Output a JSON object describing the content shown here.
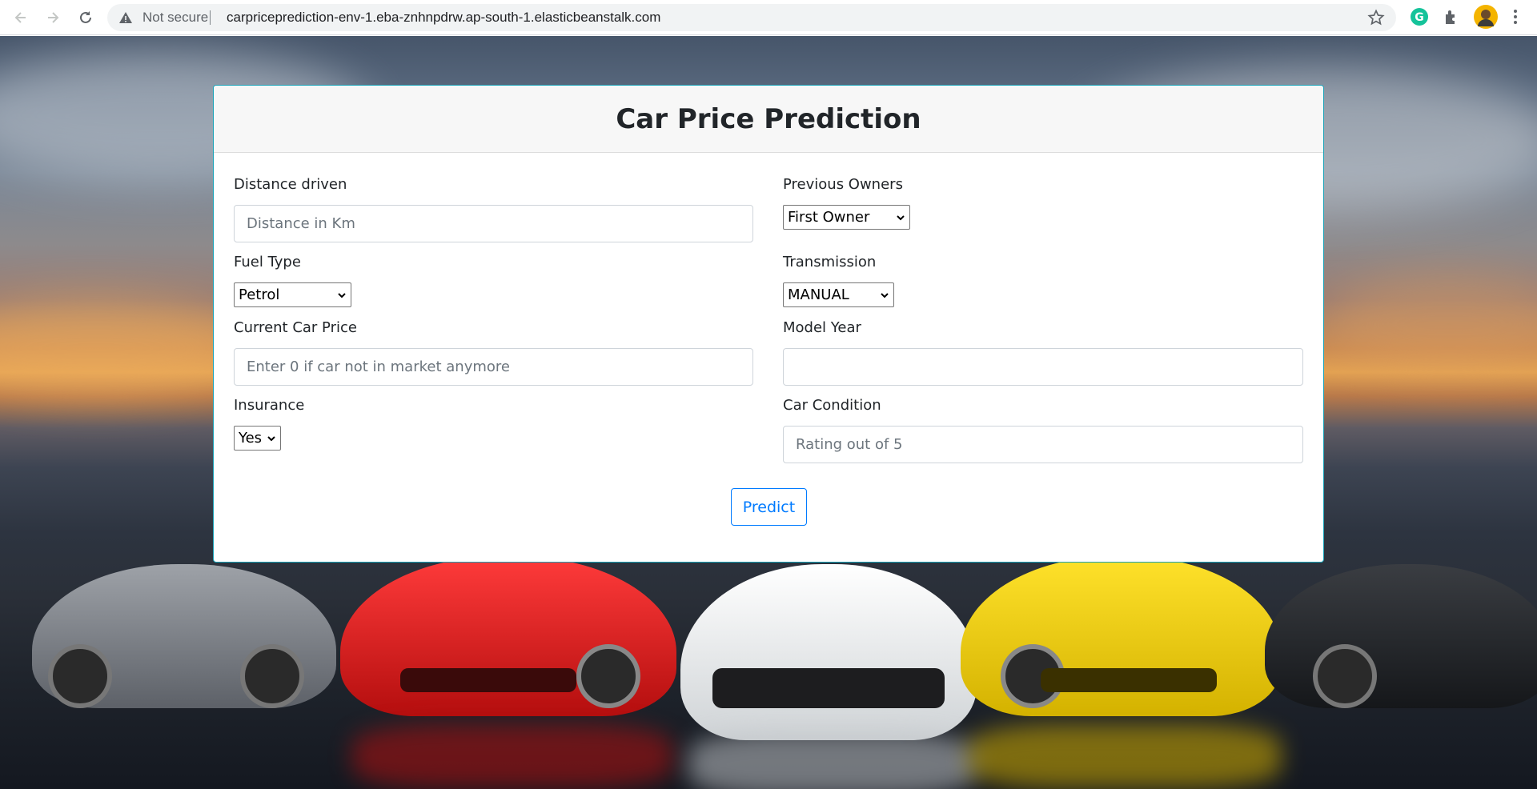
{
  "browser": {
    "security_label": "Not secure",
    "url": "carpriceprediction-env-1.eba-znhnpdrw.ap-south-1.elasticbeanstalk.com",
    "icons": [
      "back-icon",
      "forward-icon",
      "reload-icon",
      "warning-icon",
      "bookmark-star-icon",
      "grammarly-icon",
      "extensions-icon",
      "profile-avatar",
      "menu-icon"
    ]
  },
  "form": {
    "title": "Car Price Prediction",
    "distance": {
      "label": "Distance driven",
      "placeholder": "Distance in Km",
      "value": ""
    },
    "owners": {
      "label": "Previous Owners",
      "selected": "First Owner"
    },
    "fuel": {
      "label": "Fuel Type",
      "selected": "Petrol"
    },
    "transmission": {
      "label": "Transmission",
      "selected": "MANUAL"
    },
    "current_price": {
      "label": "Current Car Price",
      "placeholder": "Enter 0 if car not in market anymore",
      "value": ""
    },
    "model_year": {
      "label": "Model Year",
      "placeholder": "",
      "value": ""
    },
    "insurance": {
      "label": "Insurance",
      "selected": "Yes"
    },
    "condition": {
      "label": "Car Condition",
      "placeholder": "Rating out of 5",
      "value": ""
    },
    "submit_label": "Predict"
  },
  "colors": {
    "card_border": "#17a2b8",
    "button_accent": "#007bff",
    "header_bg": "#f7f7f7"
  }
}
